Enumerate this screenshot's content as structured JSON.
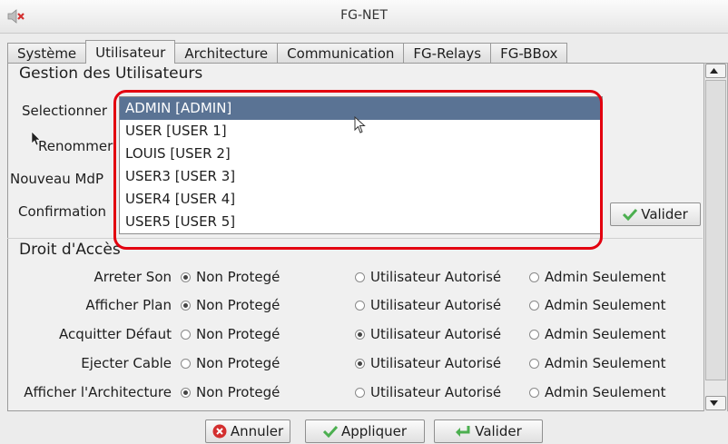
{
  "window": {
    "title": "FG-NET"
  },
  "tabs": [
    {
      "label": "Système"
    },
    {
      "label": "Utilisateur"
    },
    {
      "label": "Architecture"
    },
    {
      "label": "Communication"
    },
    {
      "label": "FG-Relays"
    },
    {
      "label": "FG-BBox"
    }
  ],
  "users": {
    "section_title": "Gestion des Utilisateurs",
    "select_label": "Selectionner",
    "rename_label": "Renommer",
    "new_password_label": "Nouveau MdP",
    "confirm_label": "Confirmation",
    "validate_label": "Valider",
    "options": [
      "ADMIN [ADMIN]",
      "USER [USER 1]",
      "LOUIS [USER 2]",
      "USER3 [USER 3]",
      "USER4 [USER 4]",
      "USER5 [USER 5]"
    ],
    "selected_index": 0
  },
  "access": {
    "section_title": "Droit d'Accès",
    "choices": [
      "Non Protegé",
      "Utilisateur Autorisé",
      "Admin Seulement"
    ],
    "rows": [
      {
        "label": "Arreter Son",
        "selected": 0
      },
      {
        "label": "Afficher Plan",
        "selected": 0
      },
      {
        "label": "Acquitter Défaut",
        "selected": 1
      },
      {
        "label": "Ejecter Cable",
        "selected": 1
      },
      {
        "label": "Afficher l'Architecture",
        "selected": 0
      }
    ]
  },
  "footer": {
    "cancel_label": "Annuler",
    "apply_label": "Appliquer",
    "validate_label": "Valider"
  },
  "colors": {
    "highlight": "#e3000f",
    "selection": "#5a7394",
    "check_green": "#4caf50",
    "cancel_red": "#d32f2f"
  }
}
